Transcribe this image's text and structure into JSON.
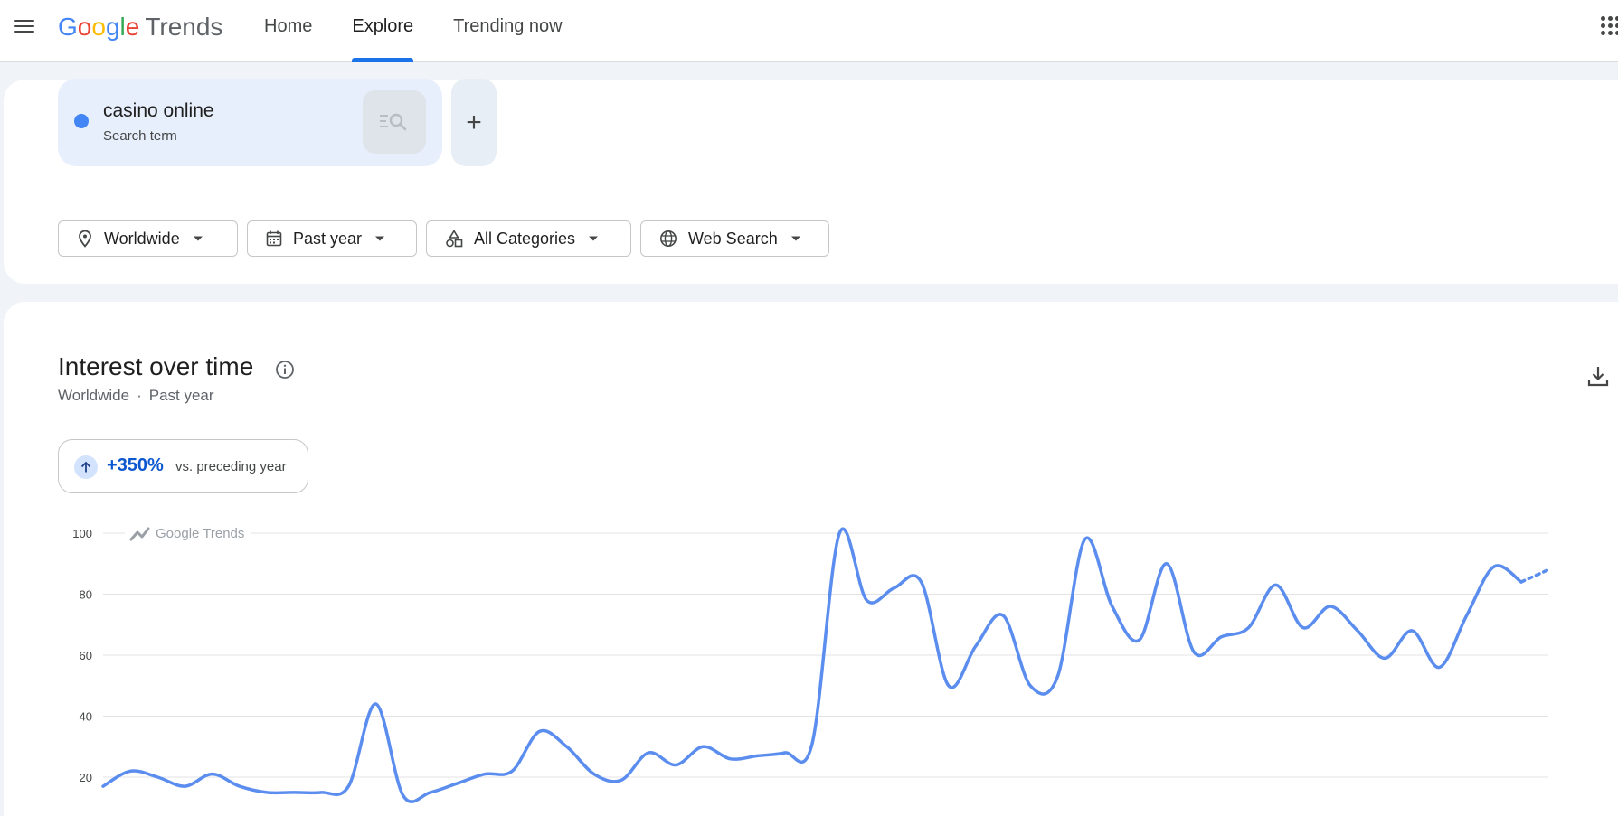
{
  "header": {
    "logo_letters": [
      {
        "ch": "G",
        "color": "#4285f4"
      },
      {
        "ch": "o",
        "color": "#ea4335"
      },
      {
        "ch": "o",
        "color": "#fbbc04"
      },
      {
        "ch": "g",
        "color": "#4285f4"
      },
      {
        "ch": "l",
        "color": "#34a853"
      },
      {
        "ch": "e",
        "color": "#ea4335"
      }
    ],
    "product": "Trends",
    "tabs": [
      {
        "label": "Home",
        "active": false
      },
      {
        "label": "Explore",
        "active": true
      },
      {
        "label": "Trending now",
        "active": false
      }
    ]
  },
  "search": {
    "term": "casino online",
    "term_type": "Search term",
    "term_color": "#4285f4",
    "add_icon": "+"
  },
  "filters": {
    "location": "Worldwide",
    "time": "Past year",
    "category": "All Categories",
    "property": "Web Search"
  },
  "interest": {
    "title": "Interest over time",
    "sub_location": "Worldwide",
    "sub_separator": "·",
    "sub_time": "Past year",
    "change_value": "+350%",
    "change_text": "vs. preceding year"
  },
  "chart_data": {
    "type": "line",
    "watermark": "Google Trends",
    "y_ticks": [
      100,
      80,
      60,
      40,
      20
    ],
    "ylim": [
      0,
      100
    ],
    "grid": true,
    "series": [
      {
        "color": "#5b8def",
        "values": [
          17,
          22,
          20,
          17,
          21,
          17,
          15,
          15,
          15,
          17,
          44,
          14,
          15,
          18,
          21,
          22,
          35,
          30,
          21,
          19,
          28,
          24,
          30,
          26,
          27,
          28,
          31,
          100,
          78,
          82,
          84,
          50,
          63,
          73,
          50,
          53,
          98,
          76,
          65,
          90,
          61,
          66,
          69,
          83,
          69,
          76,
          68,
          59,
          68,
          56,
          73,
          89,
          84
        ],
        "partial_tail": [
          84,
          88
        ]
      }
    ]
  }
}
